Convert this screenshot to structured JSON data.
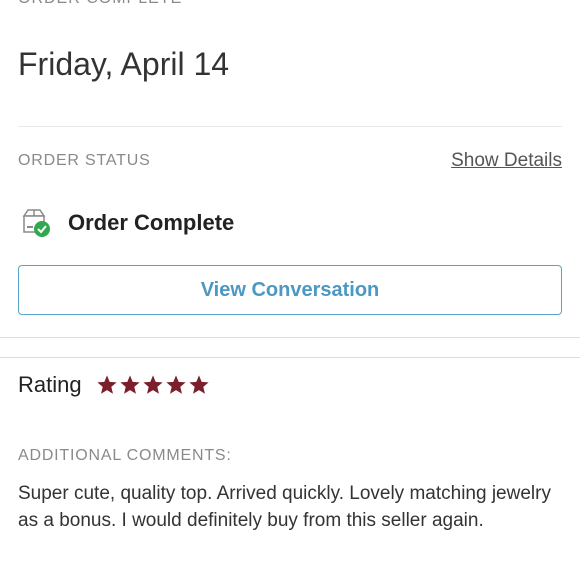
{
  "header": {
    "section_heading": "ORDER COMPLETE",
    "date": "Friday, April 14"
  },
  "order_status": {
    "label": "ORDER STATUS",
    "show_details": "Show Details",
    "status_icon": "box-check-icon",
    "status_text": "Order Complete",
    "accent_color": "#4b98c3",
    "status_check_color": "#2fa84f"
  },
  "actions": {
    "view_conversation": "View Conversation"
  },
  "rating": {
    "label": "Rating",
    "stars": 5,
    "max_stars": 5,
    "star_color": "#7a1f2b",
    "star_icon": "star-icon"
  },
  "comments": {
    "label": "ADDITIONAL COMMENTS:",
    "text": "Super cute, quality top. Arrived quickly. Lovely matching jewelry as a bonus. I would definitely buy from this seller again."
  }
}
